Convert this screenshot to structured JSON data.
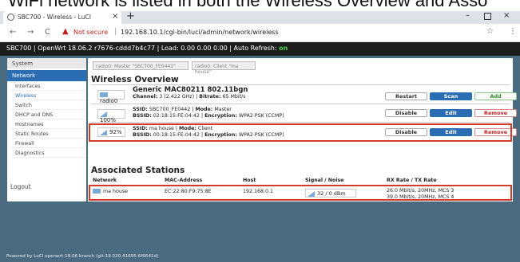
{
  "caption": "WiFi network is listed in both the Wireless Overview and Asso",
  "browser": {
    "tab_title": "SBC700 - Wireless - LuCI",
    "tab_close": "×",
    "new_tab": "+",
    "window_min": "–",
    "window_close": "×",
    "nav_back": "←",
    "nav_forward": "→",
    "nav_reload": "C",
    "warning_glyph": "▲",
    "not_secure": "Not secure",
    "separator": "|",
    "url": "192.168.10.1/cgi-bin/luci/admin/network/wireless",
    "star_glyph": "☆",
    "menu_glyph": "⋮"
  },
  "header": {
    "status_prefix": "SBC700 | OpenWrt 18.06.2 r7676-cddd7b4c77 | Load: 0.00 0.00 0.00 | Auto Refresh: ",
    "auto_refresh": "on"
  },
  "sidebar": {
    "system": "System",
    "network": "Network",
    "items": [
      "Interfaces",
      "Wireless",
      "Switch",
      "DHCP and DNS",
      "Hostnames",
      "Static Routes",
      "Firewall",
      "Diagnostics"
    ],
    "active_index": 1,
    "logout": "Logout"
  },
  "tabs": [
    "radio0: Master \"SBC700_FE0442\"",
    "radio0: Client \"ma house\""
  ],
  "overview": {
    "title": "Wireless Overview",
    "radio": {
      "device": "radio0",
      "name": "Generic MAC80211 802.11bgn",
      "channel_label": "Channel:",
      "channel": "3 (2.422 GHz)",
      "bitrate_label": "Bitrate:",
      "bitrate": "65 Mbit/s",
      "buttons": {
        "restart": "Restart",
        "scan": "Scan",
        "add": "Add"
      }
    },
    "networks": [
      {
        "signal": "100%",
        "ssid_label": "SSID:",
        "ssid": "SBC700_FE0442",
        "mode_label": "Mode:",
        "mode": "Master",
        "bssid_label": "BSSID:",
        "bssid": "02:18:15:FE:04:42",
        "enc_label": "Encryption:",
        "encryption": "WPA2 PSK (CCMP)",
        "buttons": {
          "disable": "Disable",
          "edit": "Edit",
          "remove": "Remove"
        }
      },
      {
        "signal": "92%",
        "ssid_label": "SSID:",
        "ssid": "ma house",
        "mode_label": "Mode:",
        "mode": "Client",
        "bssid_label": "BSSID:",
        "bssid": "00:18:15:FE:04:42",
        "enc_label": "Encryption:",
        "encryption": "WPA2 PSK (CCMP)",
        "buttons": {
          "disable": "Disable",
          "edit": "Edit",
          "remove": "Remove"
        }
      }
    ]
  },
  "stations": {
    "title": "Associated Stations",
    "columns": [
      "Network",
      "MAC-Address",
      "Host",
      "Signal / Noise",
      "RX Rate / TX Rate"
    ],
    "rows": [
      {
        "network": "ma house",
        "mac": "EC:22:80:F9:75:8E",
        "host": "192.168.0.1",
        "signal_noise": "32 / 0 dBm",
        "rx_rate": "26.0 Mbit/s, 20MHz, MCS 3",
        "tx_rate": "39.0 Mbit/s, 20MHz, MCS 4"
      }
    ]
  },
  "footer": "Powered by LuCI openwrt-18.06 branch (git-19.020.41695-6f6641d)"
}
